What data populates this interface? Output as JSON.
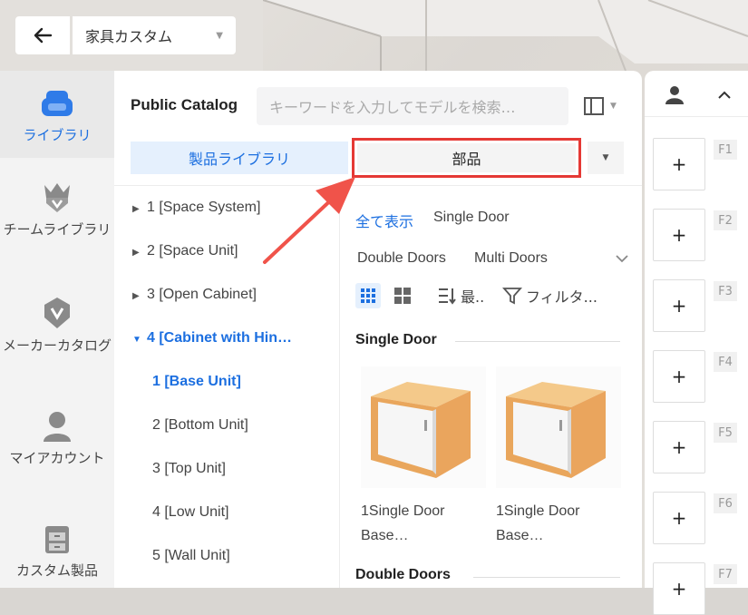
{
  "header": {
    "title": "家具カスタム"
  },
  "rail": {
    "items": [
      {
        "label": "ライブラリ",
        "active": true
      },
      {
        "label": "チームライブラリ"
      },
      {
        "label": "メーカーカタログ"
      },
      {
        "label": "マイアカウント"
      },
      {
        "label": "カスタム製品"
      }
    ]
  },
  "catalog": {
    "title": "Public Catalog",
    "search_placeholder": "キーワードを入力してモデルを検索…",
    "tabs": {
      "product": "製品ライブラリ",
      "parts": "部品"
    }
  },
  "tree": [
    {
      "label": "1 [Space System]"
    },
    {
      "label": "2 [Space Unit]"
    },
    {
      "label": "3 [Open Cabinet]"
    },
    {
      "label": "4 [Cabinet with Hin…",
      "expanded": true
    },
    {
      "label": "1 [Base Unit]",
      "child": true,
      "selected": true
    },
    {
      "label": "2 [Bottom Unit]",
      "child": true
    },
    {
      "label": "3 [Top Unit]",
      "child": true
    },
    {
      "label": "4 [Low Unit]",
      "child": true
    },
    {
      "label": "5 [Wall Unit]",
      "child": true
    }
  ],
  "filters": {
    "show_all": "全て表示",
    "single_door": "Single Door",
    "double_doors": "Double Doors",
    "multi_doors": "Multi Doors"
  },
  "toolbar": {
    "sort_label": "最..",
    "filter_label": "フィルタ..."
  },
  "sections": [
    {
      "title": "Single Door",
      "items": [
        {
          "name_line1": "1Single Door",
          "name_line2": "Base…"
        },
        {
          "name_line1": "1Single Door",
          "name_line2": "Base…"
        }
      ]
    },
    {
      "title": "Double Doors"
    }
  ],
  "shortcuts": {
    "slot_symbol": "+",
    "keys": [
      "F1",
      "F2",
      "F3",
      "F4",
      "F5",
      "F6",
      "F7"
    ]
  },
  "colors": {
    "accent": "#1c6fe0",
    "highlight_box": "#e53935",
    "arrow": "#f0534a"
  }
}
